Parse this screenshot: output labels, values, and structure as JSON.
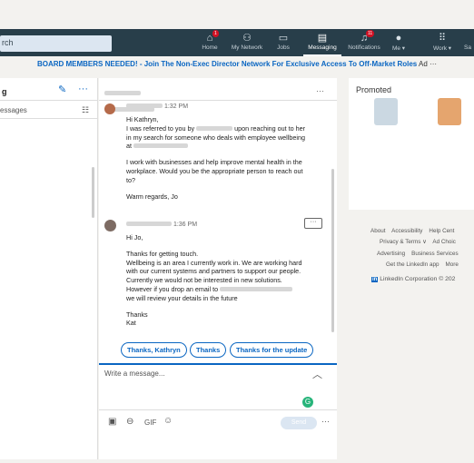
{
  "search": {
    "placeholder": "rch"
  },
  "nav": [
    {
      "label": "Home",
      "icon": "home-icon"
    },
    {
      "label": "My Network",
      "icon": "network-icon"
    },
    {
      "label": "Jobs",
      "icon": "briefcase-icon"
    },
    {
      "label": "Messaging",
      "icon": "messaging-icon"
    },
    {
      "label": "Notifications",
      "icon": "bell-icon"
    },
    {
      "label": "Me ▾",
      "icon": "avatar-icon"
    },
    {
      "label": "Work ▾",
      "icon": "grid-icon"
    },
    {
      "label": "Sa",
      "icon": ""
    }
  ],
  "badges": {
    "home": "1",
    "notifications": "11"
  },
  "ad": {
    "headline": "BOARD MEMBERS NEEDED!",
    "text": " - Join The Non-Exec Director Network For Exclusive Access To Off-Market Roles",
    "tag": "Ad",
    "more": "···"
  },
  "left": {
    "title": "g",
    "filter": "essages"
  },
  "conversation": {
    "header_more": "···",
    "msg1_time": "1:32 PM",
    "msg1_lines": [
      "Hi Kathryn,",
      "I was referred to you by",
      "upon reaching out to her",
      "in my search for someone who deals with employee wellbeing",
      "at",
      "I work with businesses and help improve mental health in the",
      "workplace. Would you be the appropriate person to reach out",
      "to?",
      "Warm regards, Jo"
    ],
    "msg2_time": "1:36 PM",
    "msg2_more": "···",
    "msg2_lines": [
      "Hi Jo,",
      "Thanks for getting touch.",
      "Wellbeing is an area I currently work in. We are working hard",
      "with our current systems and partners to support our people.",
      "Currently we would not be interested in new solutions.",
      "However if you drop an email to",
      "we will review your details in the future",
      "Thanks",
      "Kat"
    ],
    "quick_replies": [
      "Thanks, Kathryn",
      "Thanks",
      "Thanks for the update"
    ],
    "compose_placeholder": "Write a message...",
    "send": "Send",
    "compose_more": "···",
    "gif": "GIF"
  },
  "promoted": {
    "title": "Promoted"
  },
  "footer": {
    "row1": [
      "About",
      "Accessibility",
      "Help Cent"
    ],
    "row2": [
      "Privacy & Terms ∨",
      "Ad Choic"
    ],
    "row3": [
      "Advertising",
      "Business Services"
    ],
    "row4": [
      "Get the LinkedIn app",
      "More"
    ],
    "copyright": "LinkedIn Corporation © 202"
  }
}
